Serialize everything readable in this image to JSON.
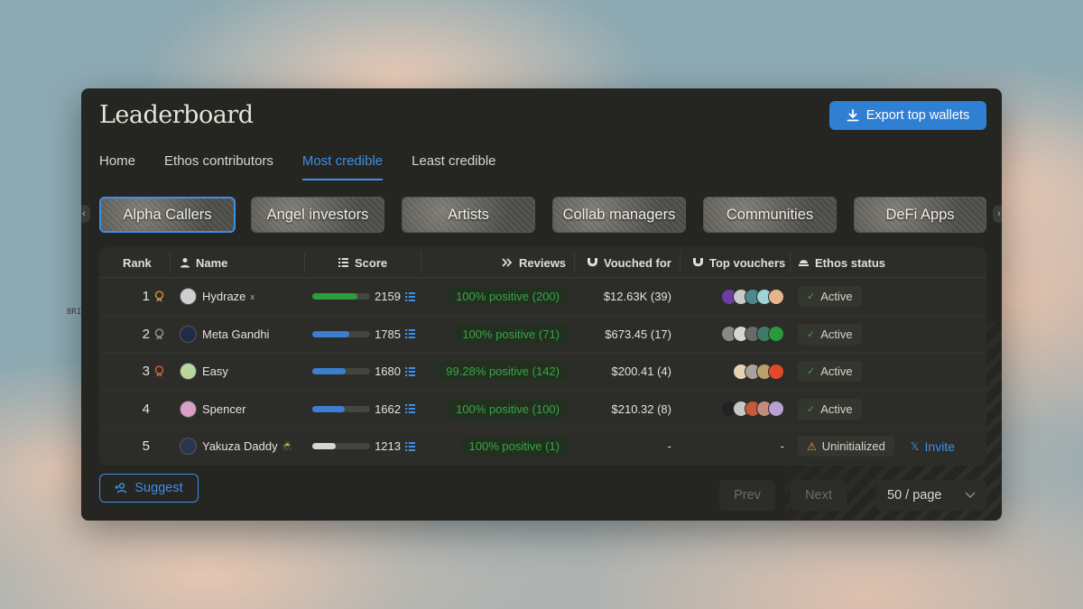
{
  "background_text": "BRI",
  "header": {
    "title": "Leaderboard",
    "export_label": "Export top wallets"
  },
  "tabs": [
    {
      "label": "Home",
      "active": false
    },
    {
      "label": "Ethos contributors",
      "active": false
    },
    {
      "label": "Most credible",
      "active": true
    },
    {
      "label": "Least credible",
      "active": false
    }
  ],
  "categories": [
    {
      "label": "Alpha Callers",
      "active": true
    },
    {
      "label": "Angel investors",
      "active": false
    },
    {
      "label": "Artists",
      "active": false
    },
    {
      "label": "Collab managers",
      "active": false
    },
    {
      "label": "Communities",
      "active": false
    },
    {
      "label": "DeFi Apps",
      "active": false
    }
  ],
  "columns": {
    "rank": "Rank",
    "name": "Name",
    "score": "Score",
    "reviews": "Reviews",
    "vouched_for": "Vouched for",
    "top_vouchers": "Top vouchers",
    "ethos_status": "Ethos status"
  },
  "rows": [
    {
      "rank": "1",
      "medal": "gold",
      "name": "Hydraze",
      "badge": "x",
      "score": "2159",
      "score_level": 0.78,
      "score_color": "#2e9e3d",
      "reviews": "100% positive (200)",
      "vouched_for": "$12.63K (39)",
      "status": "Active",
      "voucher_colors": [
        "#6b3fa0",
        "#c9c9c9",
        "#4a8a8f",
        "#9fd3d8",
        "#e8b48a"
      ]
    },
    {
      "rank": "2",
      "medal": "silver",
      "name": "Meta Gandhi",
      "badge": "",
      "score": "1785",
      "score_level": 0.64,
      "score_color": "#3a7fd0",
      "reviews": "100% positive (71)",
      "vouched_for": "$673.45 (17)",
      "status": "Active",
      "voucher_colors": [
        "#888888",
        "#d5d5d5",
        "#6a6a6a",
        "#3d7a68",
        "#2a9a3a"
      ]
    },
    {
      "rank": "3",
      "medal": "bronze",
      "name": "Easy",
      "badge": "",
      "score": "1680",
      "score_level": 0.58,
      "score_color": "#3a7fd0",
      "reviews": "99.28% positive (142)",
      "vouched_for": "$200.41 (4)",
      "status": "Active",
      "voucher_colors": [
        "#e6d3b5",
        "#a8a39a",
        "#b8a06d",
        "#e24a2a"
      ]
    },
    {
      "rank": "4",
      "medal": "",
      "name": "Spencer",
      "badge": "",
      "score": "1662",
      "score_level": 0.57,
      "score_color": "#3a7fd0",
      "reviews": "100% positive (100)",
      "vouched_for": "$210.32 (8)",
      "status": "Active",
      "voucher_colors": [
        "#222222",
        "#c7c7c7",
        "#c75a3a",
        "#c48a7a",
        "#b8a0d0"
      ]
    },
    {
      "rank": "5",
      "medal": "",
      "name": "Yakuza Daddy",
      "badge": "🥷",
      "score": "1213",
      "score_level": 0.4,
      "score_color": "#d8d6ce",
      "reviews": "100% positive (1)",
      "vouched_for": "-",
      "status": "Uninitialized",
      "voucher_dash": "-",
      "invite_label": "Invite",
      "voucher_colors": []
    }
  ],
  "footer": {
    "suggest_label": "Suggest",
    "prev_label": "Prev",
    "next_label": "Next",
    "per_page_label": "50 / page"
  },
  "colors": {
    "accent": "#3d8fe6",
    "positive": "#3aa447",
    "warning": "#e5a21e",
    "panel": "#252522"
  }
}
